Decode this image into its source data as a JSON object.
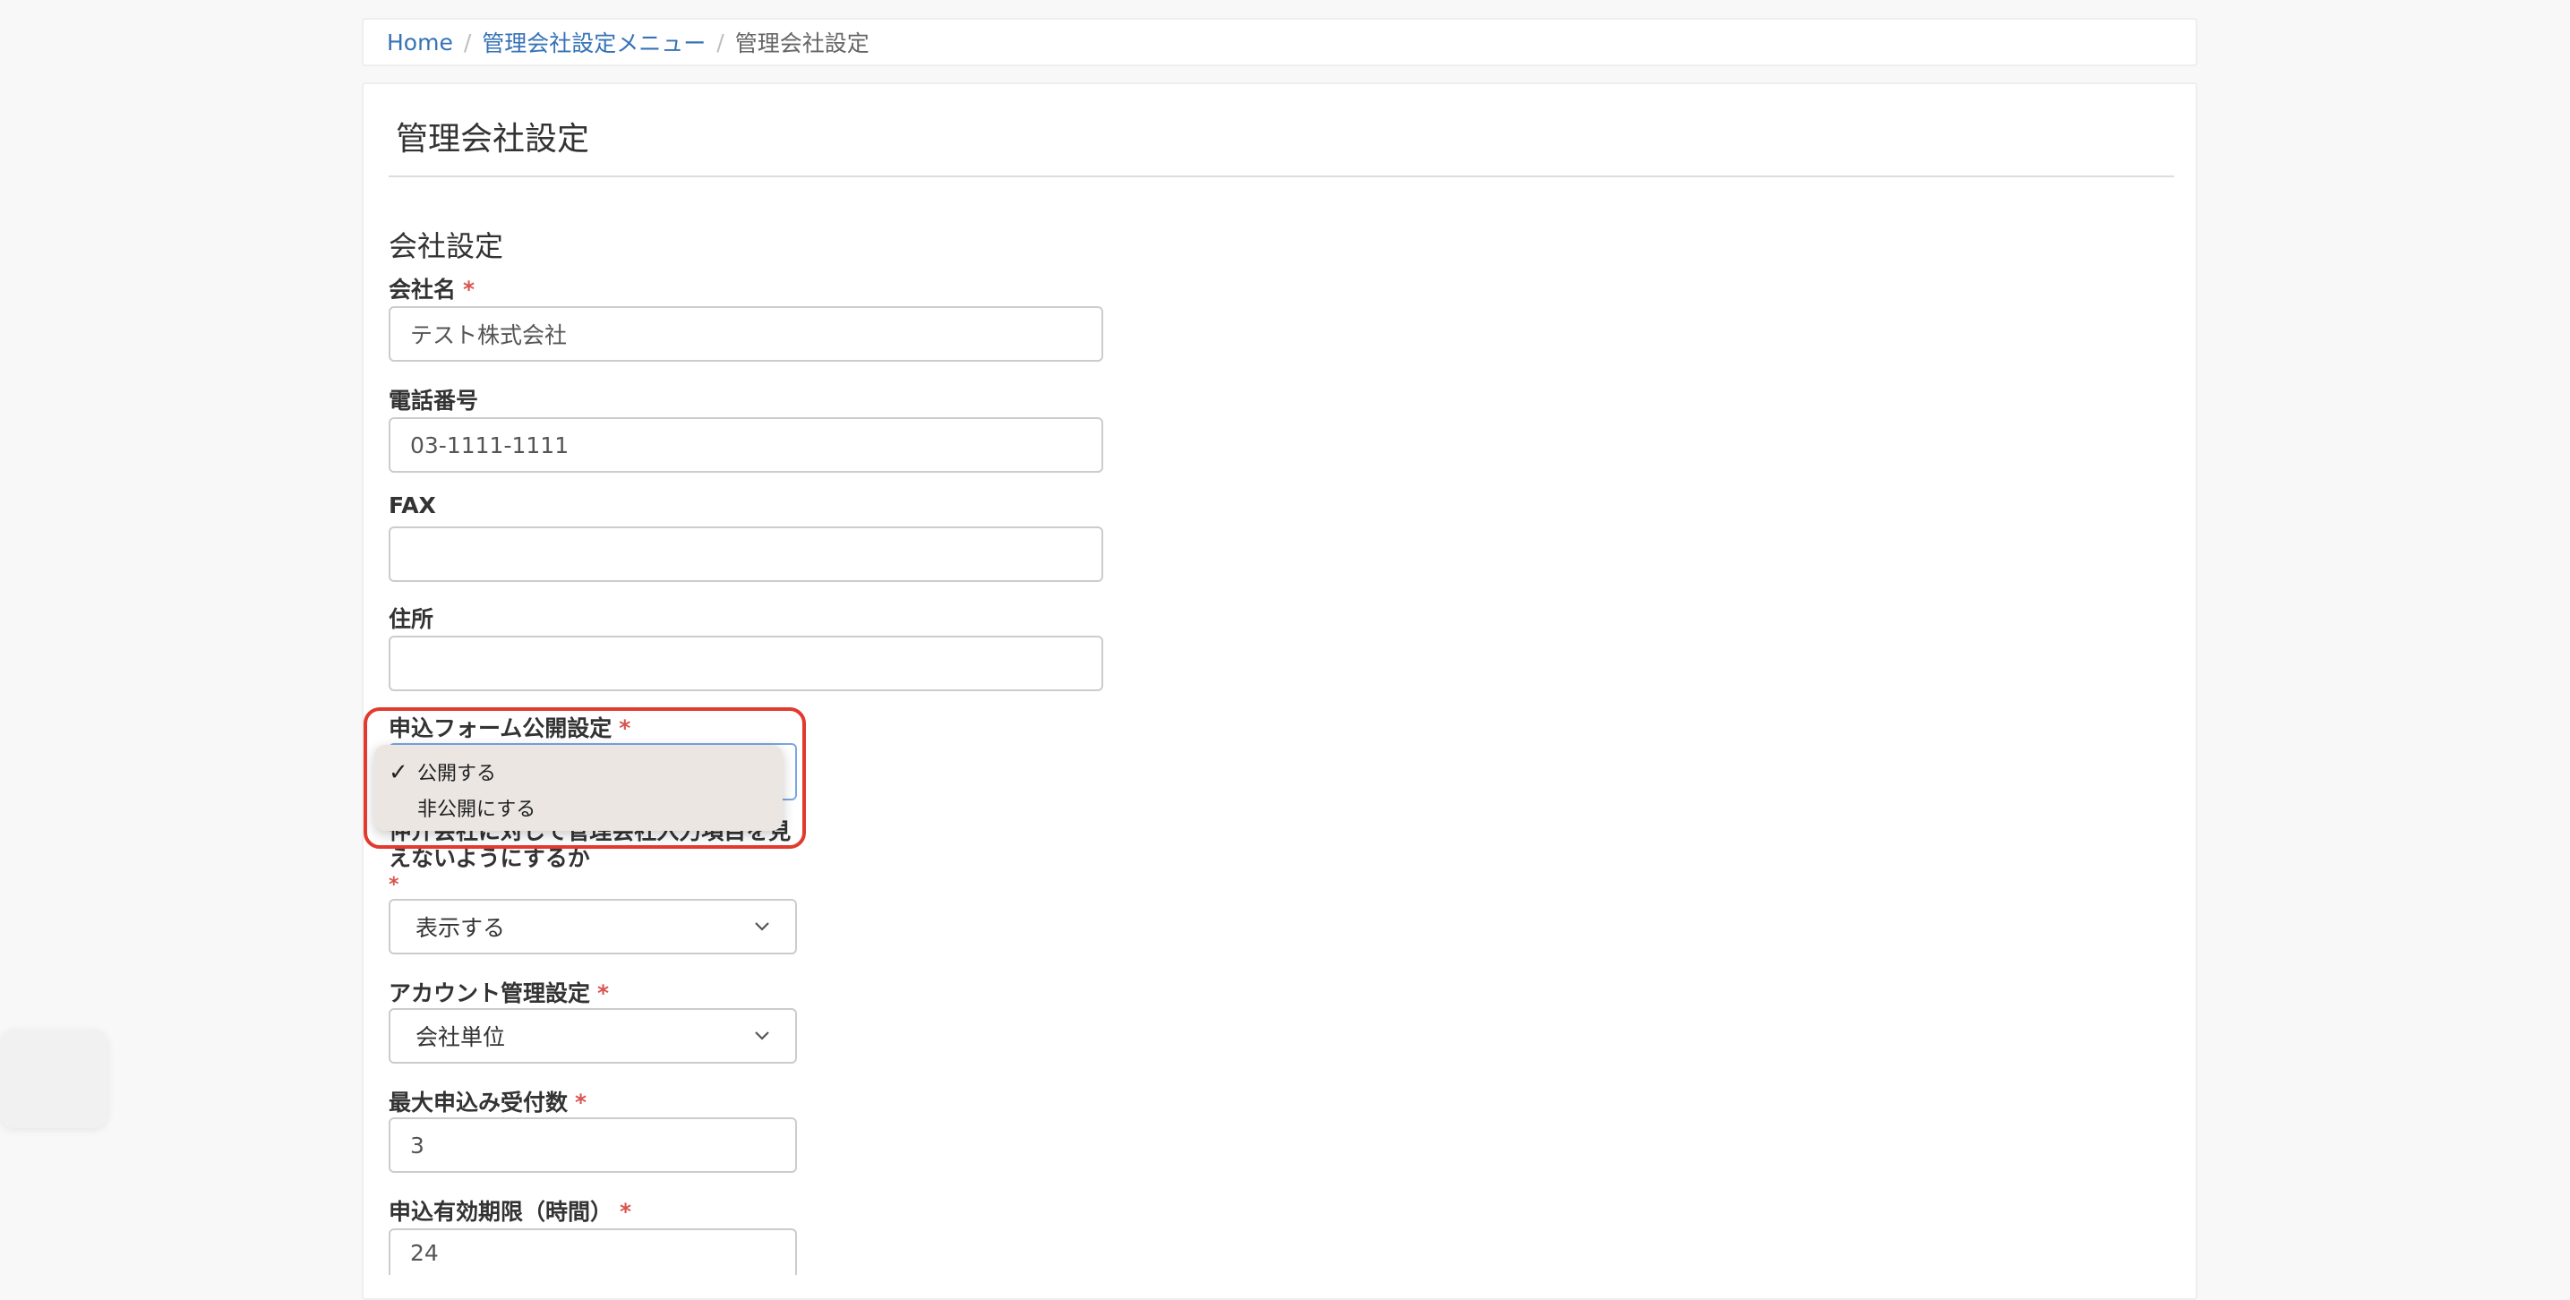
{
  "breadcrumb": {
    "home": "Home",
    "menu": "管理会社設定メニュー",
    "current": "管理会社設定"
  },
  "page": {
    "title": "管理会社設定",
    "section": "会社設定"
  },
  "form": {
    "company_name": {
      "label": "会社名",
      "required": "*",
      "value": "テスト株式会社"
    },
    "phone": {
      "label": "電話番号",
      "value": "03-1111-1111"
    },
    "fax": {
      "label": "FAX",
      "value": ""
    },
    "address": {
      "label": "住所",
      "value": ""
    },
    "form_publish": {
      "label": "申込フォーム公開設定",
      "required": "*",
      "options": [
        "公開する",
        "非公開にする"
      ],
      "selected": "公開する",
      "check_mark": "✓"
    },
    "hide_setting": {
      "label_line1": "仲介会社に対して管理会社入力項目を見",
      "label_line2": "えないようにするか",
      "required": "*",
      "value": "表示する"
    },
    "account": {
      "label": "アカウント管理設定",
      "required": "*",
      "value": "会社単位"
    },
    "max_applications": {
      "label": "最大申込み受付数",
      "required": "*",
      "value": "3"
    },
    "expiry_hours": {
      "label": "申込有効期限（時間）",
      "required": "*",
      "value": "24"
    }
  },
  "colors": {
    "link": "#3672b6",
    "required": "#d9534f",
    "highlight": "#e23a2e",
    "popup_bg": "#ebe6e2"
  }
}
